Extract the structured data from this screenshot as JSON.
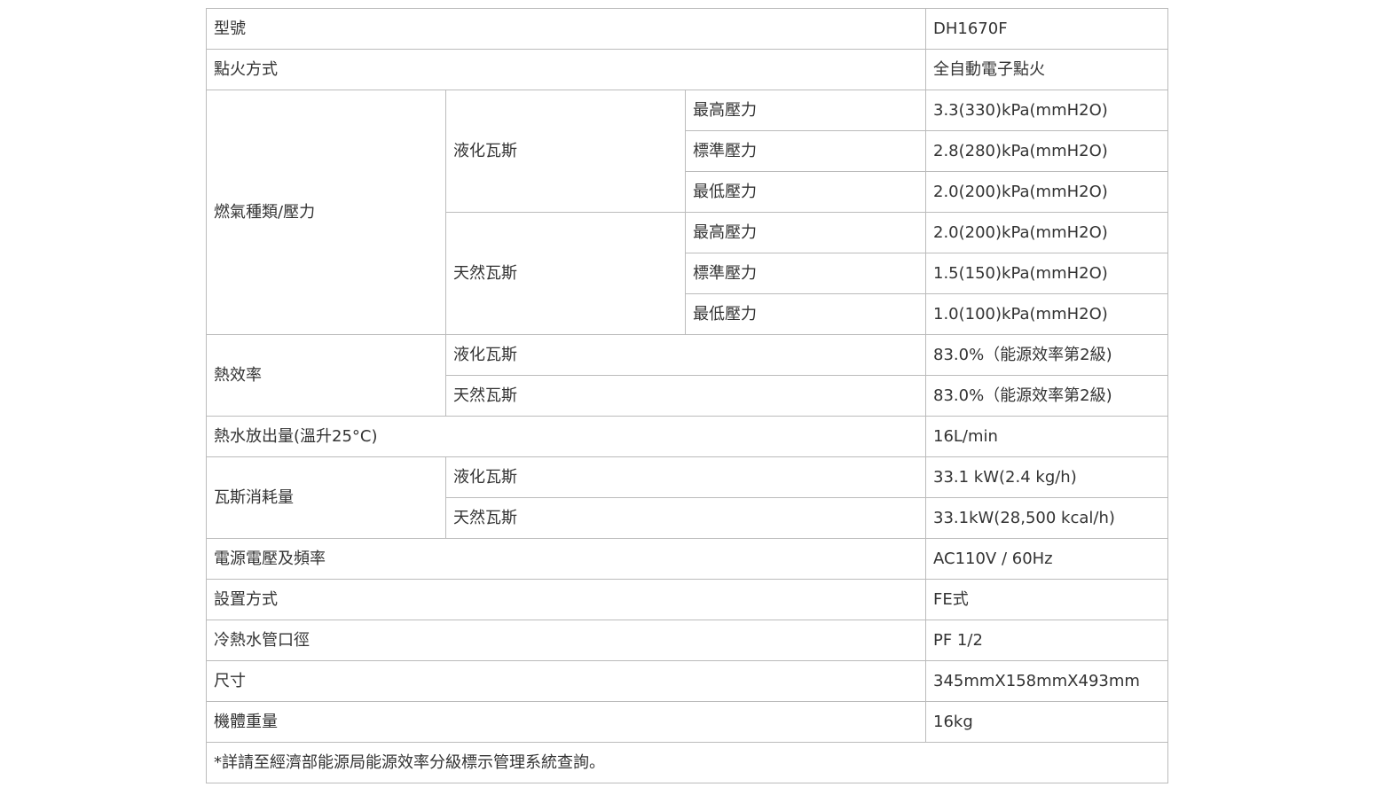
{
  "rows": {
    "model": {
      "label": "型號",
      "value": "DH1670F"
    },
    "ignition": {
      "label": "點火方式",
      "value": "全自動電子點火"
    },
    "gas": {
      "label": "燃氣種類/壓力",
      "lpg": {
        "label": "液化瓦斯",
        "max": {
          "label": "最高壓力",
          "value": "3.3(330)kPa(mmH2O)"
        },
        "std": {
          "label": "標準壓力",
          "value": "2.8(280)kPa(mmH2O)"
        },
        "min": {
          "label": "最低壓力",
          "value": "2.0(200)kPa(mmH2O)"
        }
      },
      "ng": {
        "label": "天然瓦斯",
        "max": {
          "label": "最高壓力",
          "value": "2.0(200)kPa(mmH2O)"
        },
        "std": {
          "label": "標準壓力",
          "value": "1.5(150)kPa(mmH2O)"
        },
        "min": {
          "label": "最低壓力",
          "value": "1.0(100)kPa(mmH2O)"
        }
      }
    },
    "efficiency": {
      "label": "熱效率",
      "lpg": {
        "label": "液化瓦斯",
        "value": "83.0%（能源效率第2級)"
      },
      "ng": {
        "label": "天然瓦斯",
        "value": "83.0%（能源效率第2級)"
      }
    },
    "output": {
      "label": "熱水放出量(溫升25°C)",
      "value": "16L/min"
    },
    "consumption": {
      "label": "瓦斯消耗量",
      "lpg": {
        "label": "液化瓦斯",
        "value": "33.1 kW(2.4 kg/h)"
      },
      "ng": {
        "label": "天然瓦斯",
        "value": "33.1kW(28,500 kcal/h)"
      }
    },
    "power": {
      "label": "電源電壓及頻率",
      "value": "AC110V / 60Hz"
    },
    "install": {
      "label": "設置方式",
      "value": "FE式"
    },
    "pipe": {
      "label": "冷熱水管口徑",
      "value": "PF 1/2"
    },
    "size": {
      "label": "尺寸",
      "value": "345mmX158mmX493mm"
    },
    "weight": {
      "label": "機體重量",
      "value": "16kg"
    }
  },
  "footnote": "*詳請至經濟部能源局能源效率分級標示管理系統查詢。"
}
